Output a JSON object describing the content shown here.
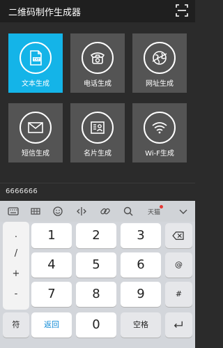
{
  "appbar": {
    "title": "二维码制作生成器",
    "right_icon": "scan-icon"
  },
  "tiles": [
    {
      "label": "文本生成",
      "icon": "txt-file-icon",
      "active": true
    },
    {
      "label": "电话生成",
      "icon": "telephone-icon",
      "active": false
    },
    {
      "label": "网址生成",
      "icon": "globe-icon",
      "active": false
    },
    {
      "label": "短信生成",
      "icon": "envelope-icon",
      "active": false
    },
    {
      "label": "名片生成",
      "icon": "contact-card-icon",
      "active": false
    },
    {
      "label": "Wi-F生成",
      "icon": "wifi-icon",
      "active": false
    }
  ],
  "input": {
    "value": "6666666"
  },
  "toolbar": {
    "tools": [
      "keyboard-grid-icon",
      "emoji-icon",
      "cursor-move-icon",
      "link-icon",
      "search-icon",
      "tianmao-logo",
      "chevron-down-icon"
    ],
    "tianmao_label": "天猫"
  },
  "keyboard": {
    "symbols": [
      ".",
      "/",
      "+",
      "-"
    ],
    "numbers": [
      "1",
      "2",
      "3",
      "4",
      "5",
      "6",
      "7",
      "8",
      "9",
      "0"
    ],
    "backspace_icon": "backspace-icon",
    "at": "@",
    "hash": "#",
    "fu": "符",
    "back_label": "返回",
    "space_label": "空格",
    "enter_icon": "enter-icon"
  },
  "colors": {
    "accent": "#14b4e8",
    "tile_bg": "#545454",
    "background": "#2b2b2b",
    "keyboard_bg": "#d3d6db",
    "link_blue": "#0f8ad6"
  }
}
